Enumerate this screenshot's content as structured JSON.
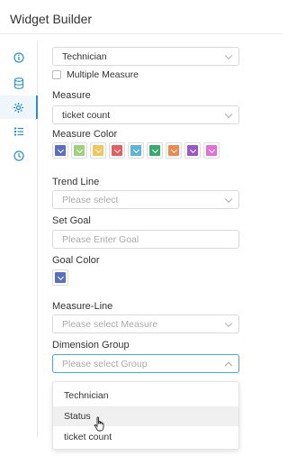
{
  "header": {
    "title": "Widget Builder"
  },
  "rail": {
    "items": [
      {
        "icon": "info-icon"
      },
      {
        "icon": "database-icon"
      },
      {
        "icon": "settings-icon",
        "active": true
      },
      {
        "icon": "list-icon"
      },
      {
        "icon": "clock-icon"
      }
    ]
  },
  "form": {
    "dimension_value": "Technician",
    "multiple_measure_label": "Multiple Measure",
    "measure_label": "Measure",
    "measure_value": "ticket count",
    "measure_color_label": "Measure Color",
    "measure_colors": [
      "#5a6fbf",
      "#9fd17a",
      "#f1c75a",
      "#e35f5f",
      "#5bb5d9",
      "#3aaa6c",
      "#f0874f",
      "#9a57c8",
      "#e06fd8"
    ],
    "trend_line_label": "Trend Line",
    "trend_line_placeholder": "Please select",
    "set_goal_label": "Set Goal",
    "set_goal_placeholder": "Please Enter Goal",
    "goal_color_label": "Goal Color",
    "goal_color": "#5a6fbf",
    "measure_line_label": "Measure-Line",
    "measure_line_placeholder": "Please select Measure",
    "dimension_group_label": "Dimension Group",
    "dimension_group_placeholder": "Please select Group"
  },
  "dropdown": {
    "options": [
      "Technician",
      "Status",
      "ticket count"
    ],
    "hovered": "Status"
  },
  "accent_color": "#2a8fc4"
}
